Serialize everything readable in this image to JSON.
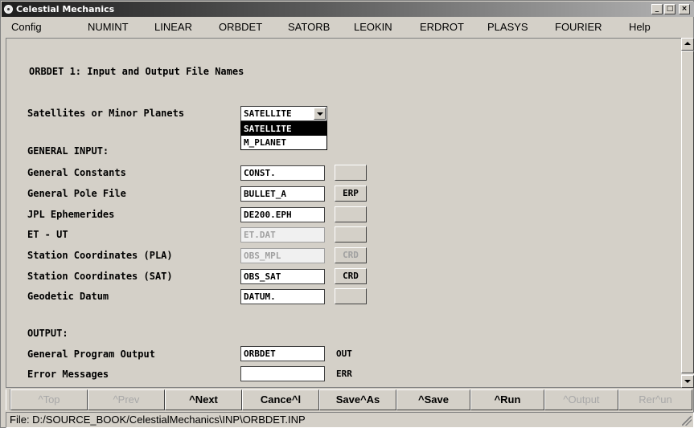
{
  "window": {
    "title": "Celestial Mechanics"
  },
  "menubar": {
    "items": [
      {
        "label": "Config"
      },
      {
        "label": "NUMINT"
      },
      {
        "label": "LINEAR"
      },
      {
        "label": "ORBDET"
      },
      {
        "label": "SATORB"
      },
      {
        "label": "LEOKIN"
      },
      {
        "label": "ERDROT"
      },
      {
        "label": "PLASYS"
      },
      {
        "label": "FOURIER"
      },
      {
        "label": "Help"
      }
    ]
  },
  "panel": {
    "heading": "ORBDET 1: Input and Output File Names",
    "object_type": {
      "label": "Satellites or Minor Planets",
      "selected": "SATELLITE",
      "options": [
        "SATELLITE",
        "M_PLANET"
      ]
    },
    "general_input_heading": "GENERAL INPUT:",
    "rows": [
      {
        "label": "General Constants",
        "value": "CONST.",
        "button": "",
        "disabled": false
      },
      {
        "label": "General Pole File",
        "value": "BULLET_A",
        "button": "ERP",
        "disabled": false
      },
      {
        "label": "JPL Ephemerides",
        "value": "DE200.EPH",
        "button": "",
        "disabled": false
      },
      {
        "label": "ET - UT",
        "value": "ET.DAT",
        "button": "",
        "disabled": true
      },
      {
        "label": "Station Coordinates (PLA)",
        "value": "OBS_MPL",
        "button": "CRD",
        "disabled": true
      },
      {
        "label": "Station Coordinates (SAT)",
        "value": "OBS_SAT",
        "button": "CRD",
        "disabled": false
      },
      {
        "label": "Geodetic Datum",
        "value": "DATUM.",
        "button": "",
        "disabled": false
      }
    ],
    "output_heading": "OUTPUT:",
    "output_rows": [
      {
        "label": "General Program Output",
        "value": "ORBDET",
        "suffix": "OUT"
      },
      {
        "label": "Error Messages",
        "value": "",
        "suffix": "ERR"
      }
    ]
  },
  "navbar": {
    "buttons": [
      {
        "label": "^Top",
        "enabled": false
      },
      {
        "label": "^Prev",
        "enabled": false
      },
      {
        "label": "^Next",
        "enabled": true
      },
      {
        "label": "Cance^l",
        "enabled": true
      },
      {
        "label": "Save^As",
        "enabled": true
      },
      {
        "label": "^Save",
        "enabled": true
      },
      {
        "label": "^Run",
        "enabled": true
      },
      {
        "label": "^Output",
        "enabled": false
      },
      {
        "label": "Rer^un",
        "enabled": false
      }
    ]
  },
  "status": {
    "text": "File: D:/SOURCE_BOOK/CelestialMechanics\\INP\\ORBDET.INP"
  }
}
